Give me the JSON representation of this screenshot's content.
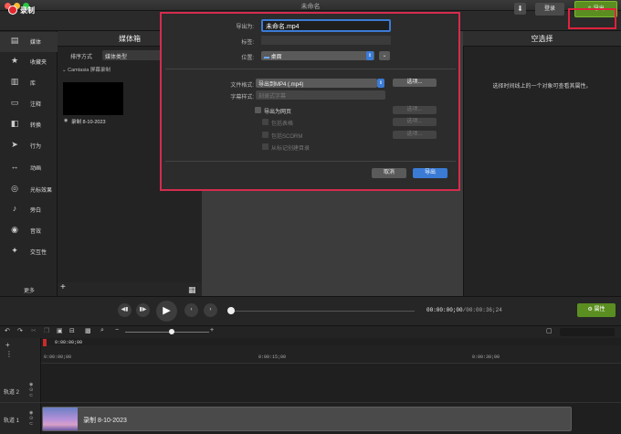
{
  "window": {
    "title": "未命名"
  },
  "toolbar": {
    "record_label": "录制",
    "login_label": "登录",
    "export_label": "导出",
    "download_icon": "download-icon"
  },
  "rail": {
    "items": [
      {
        "label": "媒体",
        "icon": "media-icon",
        "glyph": "▤"
      },
      {
        "label": "收藏夹",
        "icon": "star-icon",
        "glyph": "★"
      },
      {
        "label": "库",
        "icon": "library-icon",
        "glyph": "▥"
      },
      {
        "label": "注释",
        "icon": "annotation-icon",
        "glyph": "▭"
      },
      {
        "label": "转换",
        "icon": "transition-icon",
        "glyph": "◧"
      },
      {
        "label": "行为",
        "icon": "behavior-icon",
        "glyph": "➤"
      },
      {
        "label": "动画",
        "icon": "animation-icon",
        "glyph": "↔"
      },
      {
        "label": "光标效果",
        "icon": "cursor-effect-icon",
        "glyph": "◎"
      },
      {
        "label": "旁白",
        "icon": "microphone-icon",
        "glyph": "♪"
      },
      {
        "label": "音效",
        "icon": "audio-icon",
        "glyph": "◉"
      },
      {
        "label": "交互性",
        "icon": "interactivity-icon",
        "glyph": "✦"
      }
    ],
    "more_label": "更多"
  },
  "media_bin": {
    "title": "媒体箱",
    "sort_label": "排序方式",
    "sort_value": "媒体类型",
    "group_label": "Camtasia 屏幕录制",
    "items": [
      {
        "caption": "录制 8-10-2023"
      }
    ]
  },
  "properties": {
    "title": "空选择",
    "message": "选择时间线上的一个对象可查看其属性。",
    "button_label": "属性"
  },
  "playback": {
    "time_current": "00:00:00;00",
    "time_total": "00:00:36;24"
  },
  "timeline": {
    "playhead_time": "0:00:00;00",
    "ruler_ticks": [
      "0:00:00;00",
      "0:00:15;00",
      "0:00:30;00"
    ],
    "tracks": [
      {
        "label": "轨道 2"
      },
      {
        "label": "轨道 1",
        "clip_label": "录制 8-10-2023"
      }
    ]
  },
  "export_dialog": {
    "save_as_label": "导出为:",
    "filename": "未命名.mp4",
    "tags_label": "标签:",
    "location_label": "位置:",
    "location_value": "桌面",
    "format_label": "文件格式:",
    "format_value": "导出到MP4 (.mp4)",
    "subtitle_label": "字幕样式:",
    "subtitle_value": "刻录式字幕",
    "options_label": "选项...",
    "web_label": "导出为网页",
    "include_table_label": "包括表格",
    "include_scorm_label": "包括SCORM",
    "from_markers_label": "从标记创建目录",
    "cancel_label": "取消",
    "export_label": "导出"
  },
  "colors": {
    "accent_green": "#5b8e21",
    "accent_blue": "#3a7bd5",
    "highlight_red": "#d42c4e",
    "record_red": "#e3262d"
  }
}
